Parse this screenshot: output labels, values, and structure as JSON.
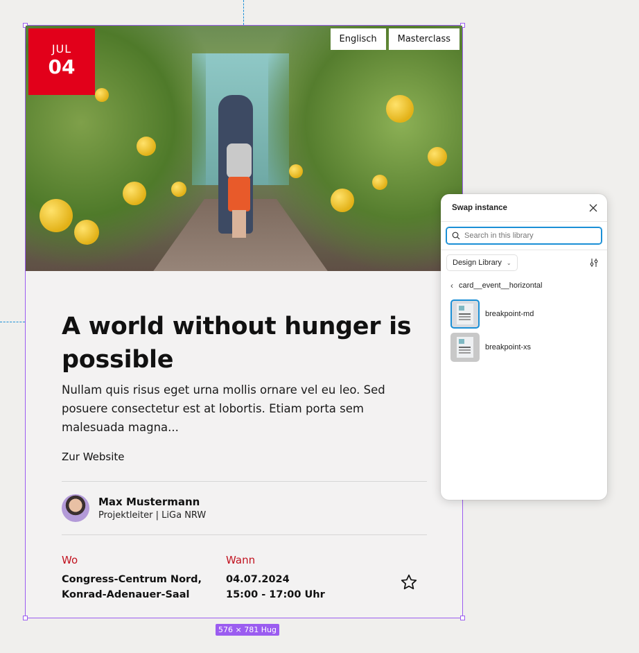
{
  "card": {
    "date_month": "JUL",
    "date_day": "04",
    "tags": [
      "Englisch",
      "Masterclass"
    ],
    "title": "A world without hunger is possible",
    "description": "Nullam quis risus eget urna mollis ornare vel eu leo. Sed posuere consectetur est at lobortis. Etiam porta sem malesuada magna...",
    "link_label": "Zur Website",
    "author": {
      "name": "Max Mustermann",
      "role": "Projektleiter | LiGa NRW"
    },
    "where": {
      "label": "Wo",
      "line1": "Congress-Centrum Nord,",
      "line2": "Konrad-Adenauer-Saal"
    },
    "when": {
      "label": "Wann",
      "date": "04.07.2024",
      "time": "15:00 - 17:00 Uhr"
    },
    "accent_color": "#e2001a"
  },
  "frame": {
    "size_label": "576 × 781 Hug",
    "selection_color": "#9b5cf0"
  },
  "swap_panel": {
    "title": "Swap instance",
    "search_placeholder": "Search in this library",
    "library": "Design Library",
    "breadcrumb": "card__event__horizontal",
    "items": [
      {
        "label": "breakpoint-md",
        "selected": true
      },
      {
        "label": "breakpoint-xs",
        "selected": false
      }
    ]
  }
}
